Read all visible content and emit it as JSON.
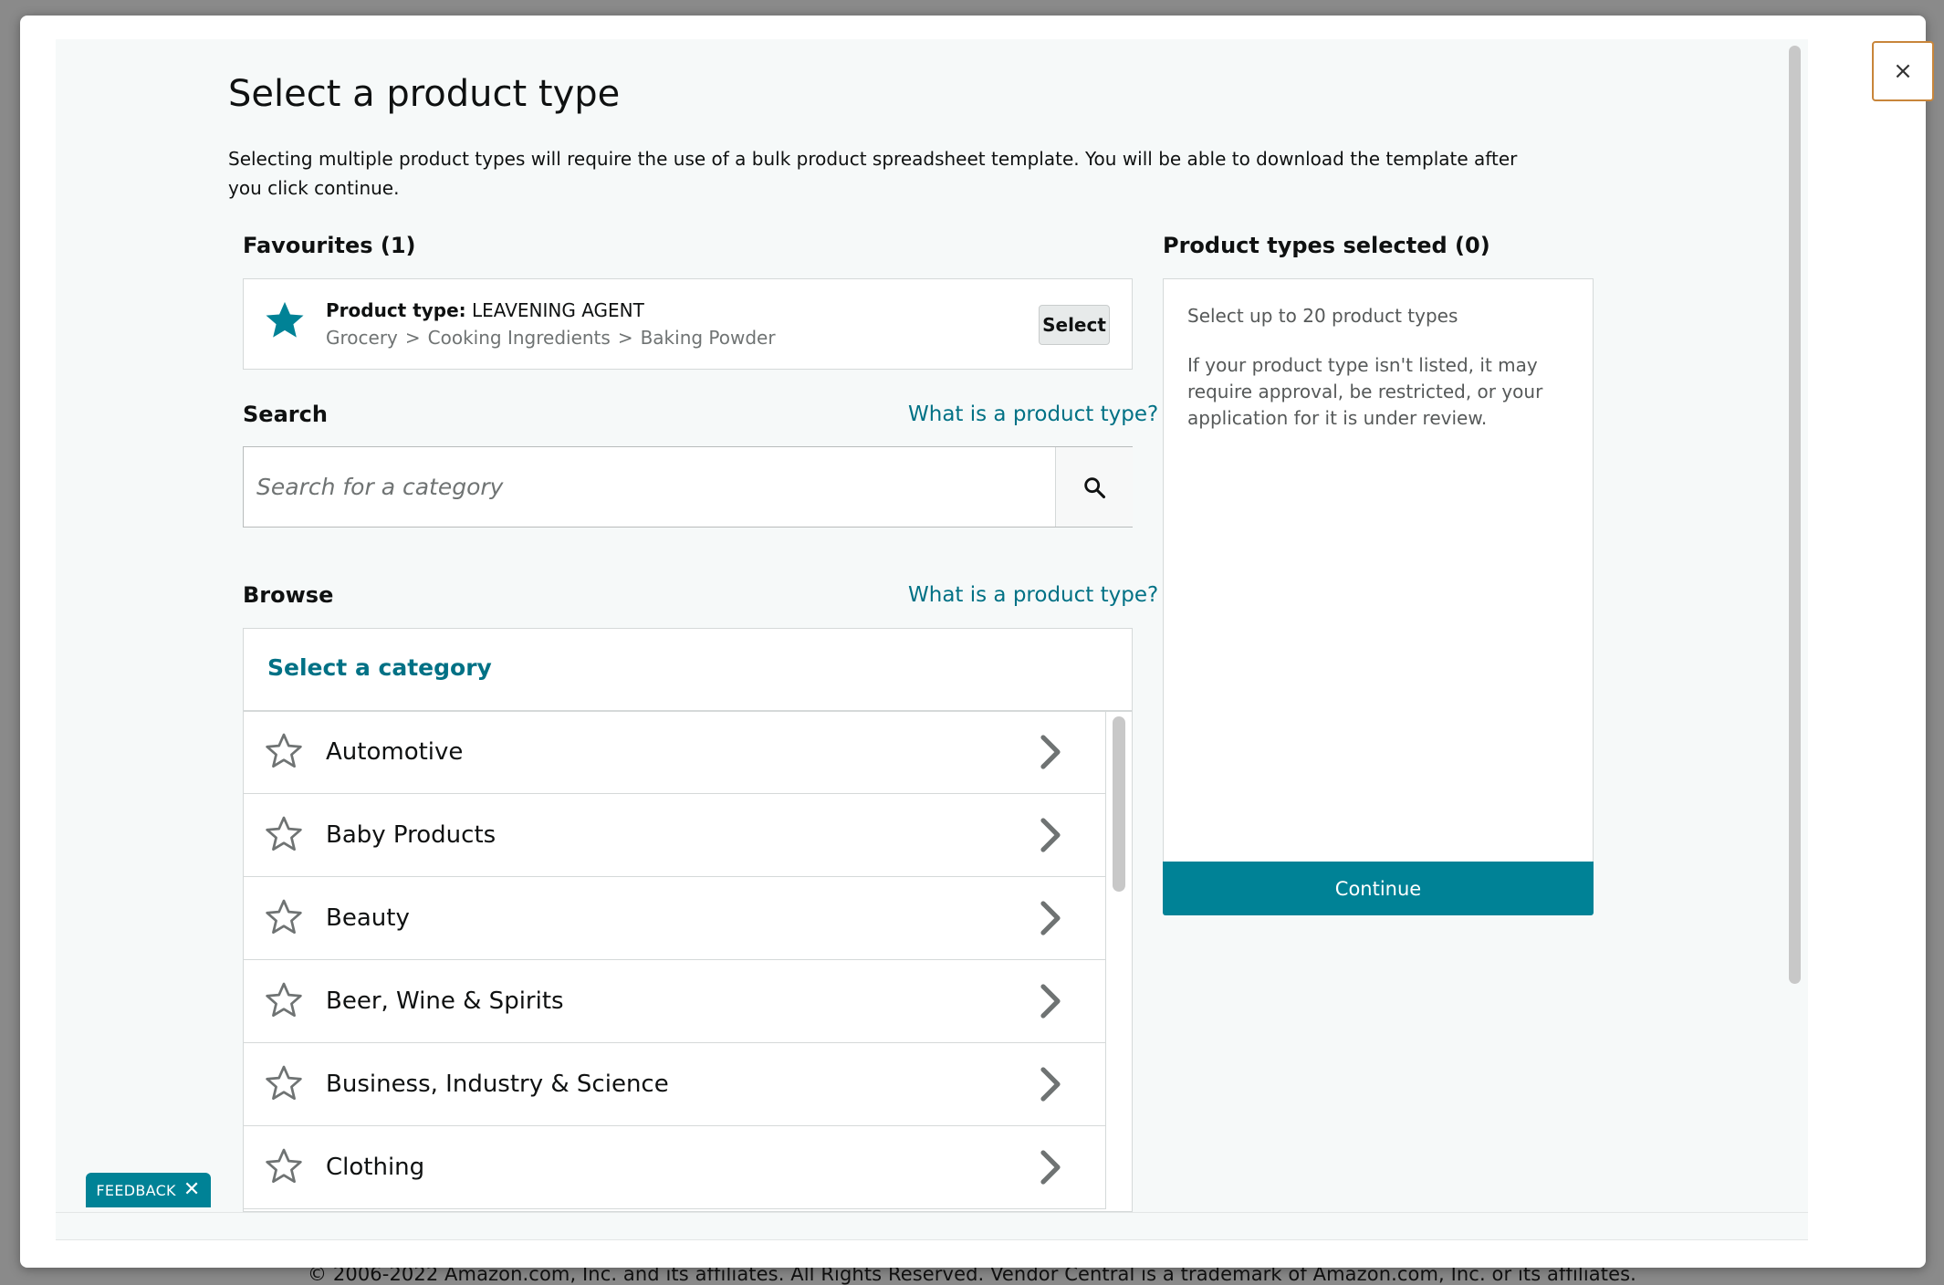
{
  "footer": {
    "copyright": "© 2006-2022 Amazon.com, Inc. and its affiliates. All Rights Reserved. Vendor Central is a trademark of Amazon.com, Inc. or its affiliates."
  },
  "modal": {
    "close_label": "×",
    "title": "Select a product type",
    "description": "Selecting multiple product types will require the use of a bulk product spreadsheet template. You will be able to download the template after you click continue."
  },
  "favourites": {
    "heading": "Favourites (1)",
    "item": {
      "type_label": "Product type:",
      "type_value": "LEAVENING AGENT",
      "path": [
        "Grocery",
        "Cooking Ingredients",
        "Baking Powder"
      ],
      "separator": ">",
      "select_label": "Select"
    }
  },
  "search": {
    "heading": "Search",
    "help_link": "What is a product type?",
    "placeholder": "Search for a category"
  },
  "browse": {
    "heading": "Browse",
    "help_link": "What is a product type?",
    "list_title": "Select a category",
    "categories": [
      {
        "label": "Automotive"
      },
      {
        "label": "Baby Products"
      },
      {
        "label": "Beauty"
      },
      {
        "label": "Beer, Wine & Spirits"
      },
      {
        "label": "Business, Industry & Science"
      },
      {
        "label": "Clothing"
      }
    ]
  },
  "selected": {
    "heading": "Product types selected (0)",
    "hint": "Select up to 20 product types",
    "note": "If your product type isn't listed, it may require approval, be restricted, or your application for it is under review.",
    "continue_label": "Continue"
  },
  "feedback": {
    "label": "FEEDBACK",
    "close_glyph": "✕"
  },
  "colors": {
    "accent": "#008296",
    "link": "#007185",
    "panel_bg": "#f6f9f9",
    "overlay": "#8a8a8a"
  }
}
